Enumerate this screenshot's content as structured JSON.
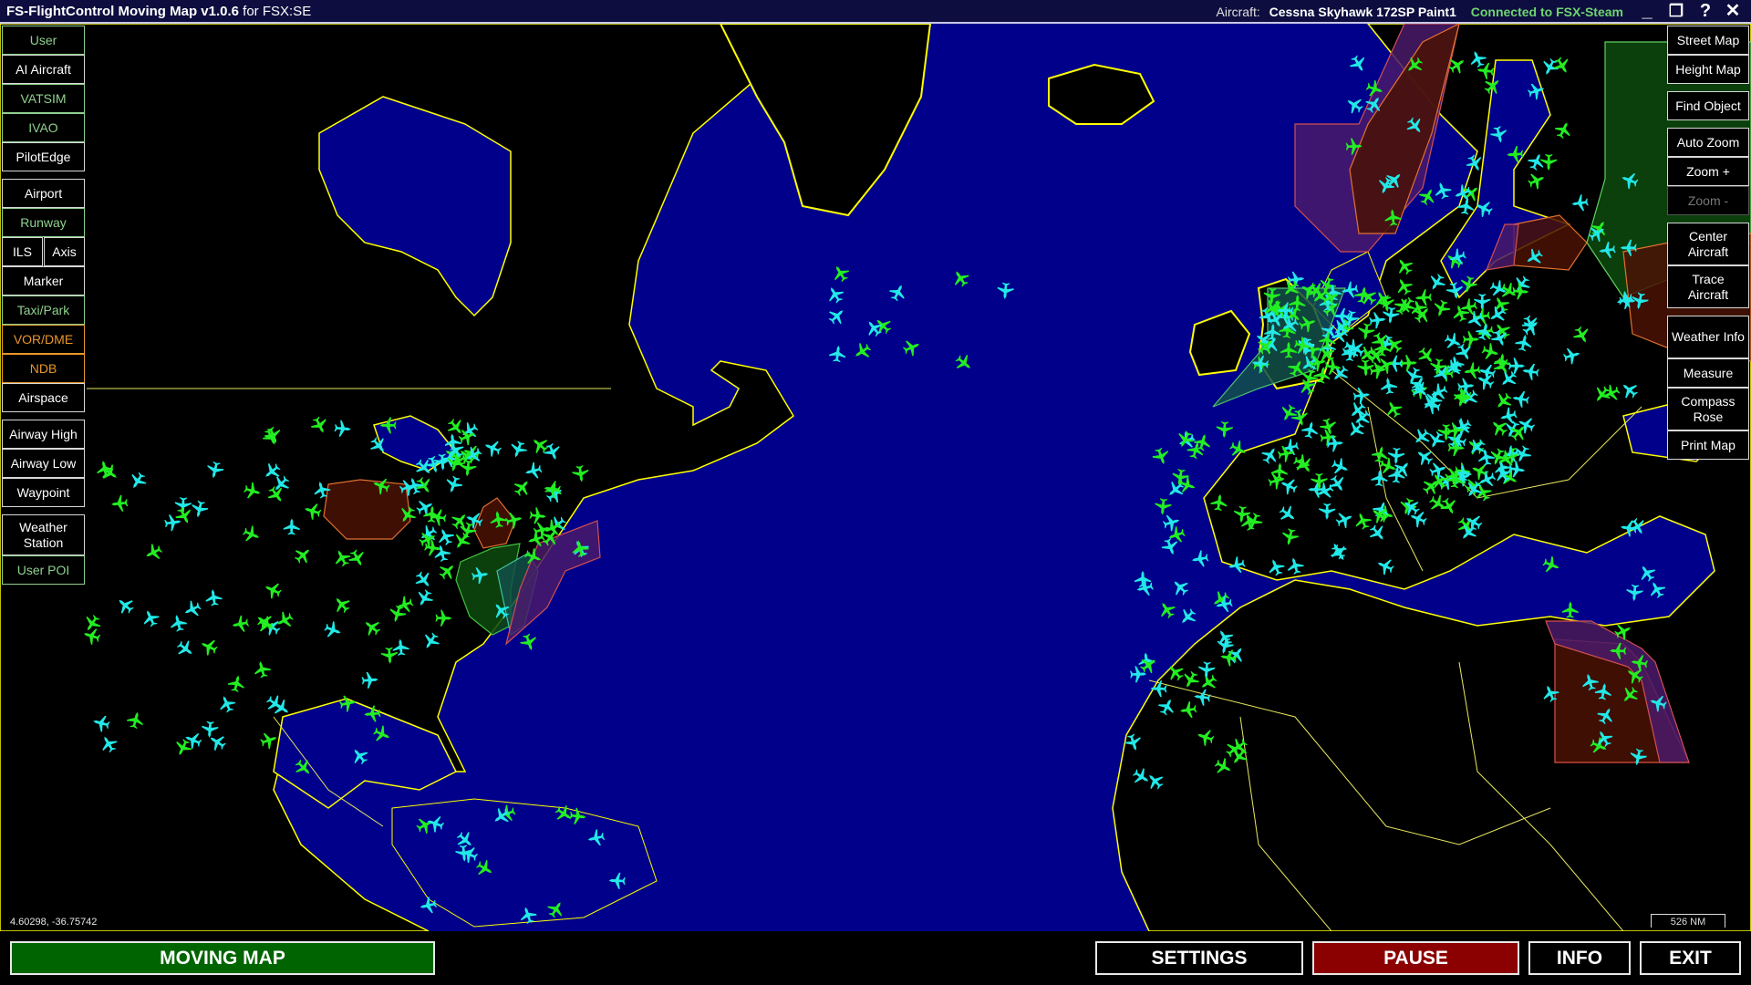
{
  "window": {
    "title_bold": "FS-FlightControl Moving Map v1.0.6",
    "title_suffix": "for FSX:SE",
    "aircraft_label": "Aircraft:",
    "aircraft_name": "Cessna Skyhawk 172SP Paint1",
    "connection_status": "Connected to FSX-Steam",
    "controls": {
      "minimize": "_",
      "restore": "❐",
      "help": "?",
      "close": "✕"
    }
  },
  "left_panel": {
    "traffic": [
      {
        "label": "User",
        "state": "on"
      },
      {
        "label": "AI Aircraft",
        "state": "off"
      },
      {
        "label": "VATSIM",
        "state": "on"
      },
      {
        "label": "IVAO",
        "state": "on"
      },
      {
        "label": "PilotEdge",
        "state": "off"
      }
    ],
    "layers": [
      {
        "label": "Airport",
        "state": "off"
      },
      {
        "label": "Runway",
        "state": "on"
      },
      {
        "label": "ILS",
        "state": "off"
      },
      {
        "label": "Axis",
        "state": "off"
      },
      {
        "label": "Marker",
        "state": "off"
      },
      {
        "label": "Taxi/Park",
        "state": "on"
      },
      {
        "label": "VOR/DME",
        "state": "orange"
      },
      {
        "label": "NDB",
        "state": "orange"
      },
      {
        "label": "Airspace",
        "state": "off"
      }
    ],
    "navigation": [
      {
        "label": "Airway High",
        "state": "off"
      },
      {
        "label": "Airway Low",
        "state": "off"
      },
      {
        "label": "Waypoint",
        "state": "off"
      }
    ],
    "extras": [
      {
        "label": "Weather Station",
        "state": "off"
      },
      {
        "label": "User POI",
        "state": "on"
      }
    ]
  },
  "right_panel": {
    "map_type": [
      {
        "label": "Street Map",
        "state": "off"
      },
      {
        "label": "Height Map",
        "state": "off"
      },
      {
        "label": "Find Object",
        "state": "off"
      }
    ],
    "zoom": [
      {
        "label": "Auto Zoom",
        "state": "off"
      },
      {
        "label": "Zoom +",
        "state": "off"
      },
      {
        "label": "Zoom -",
        "state": "disabled"
      }
    ],
    "aircraft": [
      {
        "label": "Center Aircraft",
        "state": "off"
      },
      {
        "label": "Trace Aircraft",
        "state": "off"
      }
    ],
    "tools": [
      {
        "label": "Weather Info",
        "state": "off"
      },
      {
        "label": "Measure",
        "state": "off"
      },
      {
        "label": "Compass Rose",
        "state": "off"
      },
      {
        "label": "Print Map",
        "state": "off"
      }
    ]
  },
  "map": {
    "cursor_coordinates": "4.60298, -36.75742",
    "scale_label": "526 NM",
    "colors": {
      "ocean": "#00008a",
      "land": "#000000",
      "coastline": "#ffff00",
      "border": "#f0f060",
      "aircraft_vatsim": "#22ee22",
      "aircraft_ivao": "#22e8e8",
      "airspace_restricted": "#4a1205",
      "airspace_danger": "#4a1a6a",
      "airspace_control": "#0d4a0d"
    }
  },
  "bottom_bar": {
    "moving_map": "MOVING MAP",
    "settings": "SETTINGS",
    "pause": "PAUSE",
    "info": "INFO",
    "exit": "EXIT",
    "colors": {
      "moving_map_bg": "#006400",
      "pause_bg": "#8b0000"
    }
  }
}
